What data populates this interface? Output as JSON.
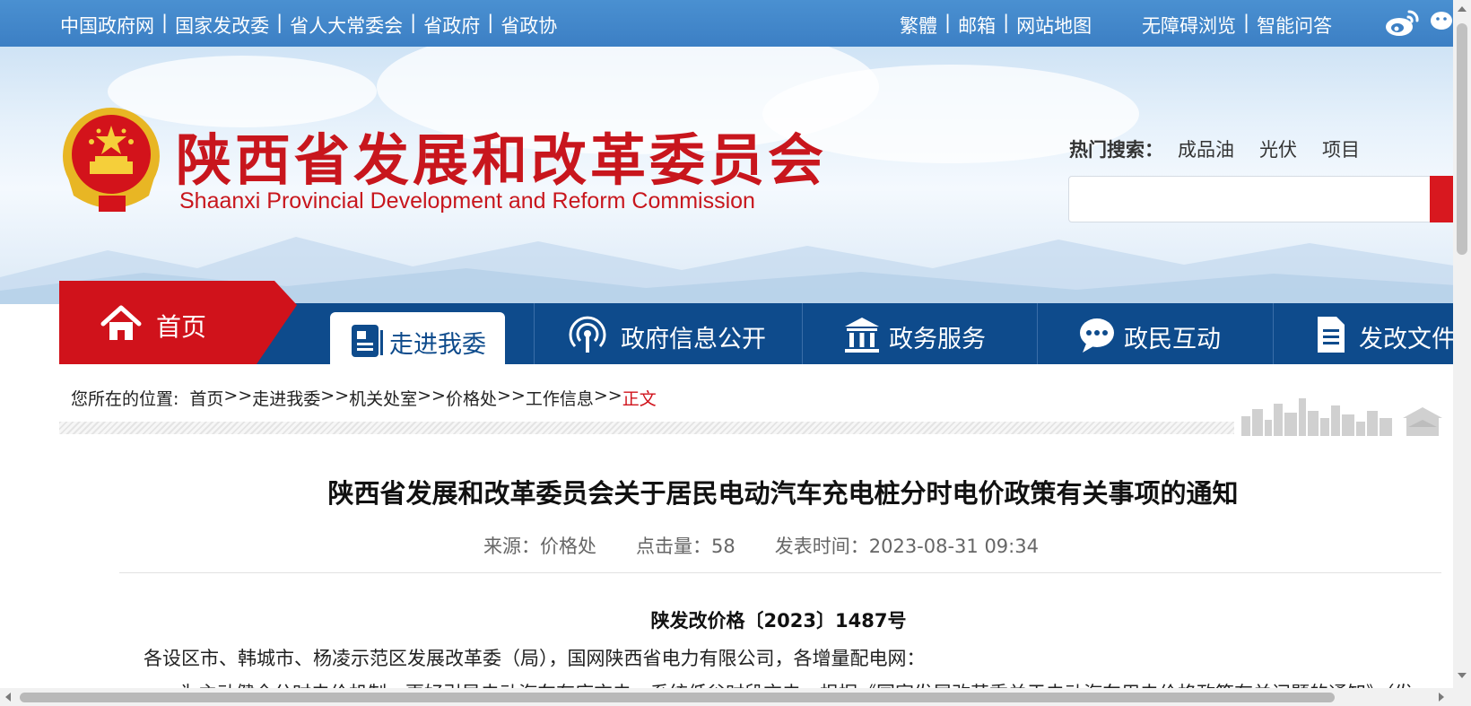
{
  "topbar": {
    "left_links": [
      "中国政府网",
      "国家发改委",
      "省人大常委会",
      "省政府",
      "省政协"
    ],
    "mid_links": [
      "繁體",
      "邮箱",
      "网站地图"
    ],
    "right_links": [
      "无障碍浏览",
      "智能问答"
    ],
    "separator": "|"
  },
  "header": {
    "title": "陕西省发展和改革委员会",
    "subtitle": "Shaanxi Provincial Development and Reform Commission",
    "hot_search": {
      "label": "热门搜索：",
      "keywords": [
        "成品油",
        "光伏",
        "项目"
      ]
    },
    "search": {
      "placeholder": ""
    }
  },
  "nav": {
    "home": "首页",
    "active": "走进我委",
    "items": [
      "政府信息公开",
      "政务服务",
      "政民互动",
      "发改文件"
    ]
  },
  "breadcrumb": {
    "label": "您所在的位置:",
    "items": [
      "首页",
      "走进我委",
      "机关处室",
      "价格处",
      "工作信息"
    ],
    "separator": ">>",
    "current": "正文"
  },
  "article": {
    "title": "陕西省发展和改革委员会关于居民电动汽车充电桩分时电价政策有关事项的通知",
    "source": "来源：价格处",
    "hits": "点击量：58",
    "published": "发表时间：2023-08-31 09:34",
    "doc_number": "陕发改价格〔2023〕1487号",
    "recipients": "各设区市、韩城市、杨凌示范区发展改革委（局），国网陕西省电力有限公司，各增量配电网：",
    "body_start": "为主动健全分时电价机制，更好引导电动汽车有序充电、系统低谷时段充电，根据《国家发展改革委关于电动汽车用电价格政策有关问题的通知》（发"
  },
  "colors": {
    "topbar": "#3c7fc4",
    "brand_red": "#c8161d",
    "nav_blue": "#0e4b8c",
    "current_crumb": "#d0121b"
  }
}
